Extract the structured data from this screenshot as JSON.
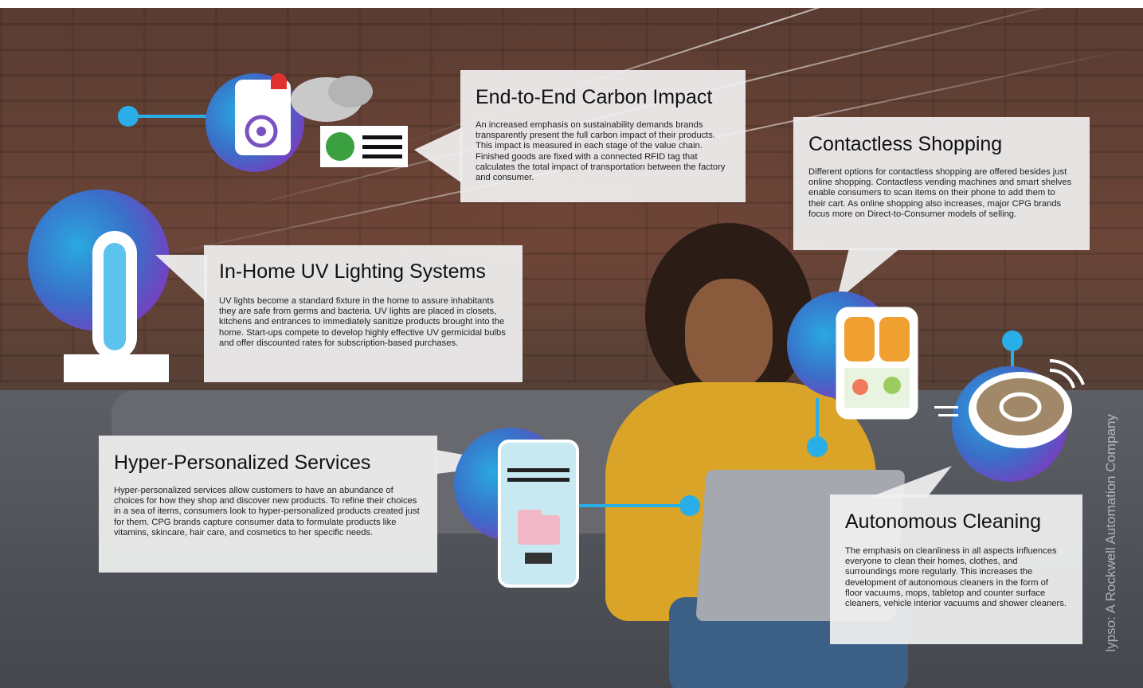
{
  "cards": {
    "carbon": {
      "title": "End-to-End Carbon Impact",
      "body": "An increased emphasis on sustainability demands brands transparently present the full carbon impact of their products. This impact is measured in each stage of the value chain. Finished goods are fixed with a connected RFID tag that calculates the total impact of transportation between the factory and consumer."
    },
    "contactless": {
      "title": "Contactless Shopping",
      "body": "Different options for contactless shopping are offered besides just online shopping. Contactless vending machines and smart shelves enable consumers to scan items on their phone to add them to their cart. As online shopping also increases, major CPG brands focus more on Direct-to-Consumer models of selling."
    },
    "uv": {
      "title": "In-Home UV Lighting Systems",
      "body": "UV lights become a standard fixture in the home to assure inhabitants they are safe from germs and bacteria. UV lights are placed in closets, kitchens and entrances to immediately sanitize products brought into the home. Start-ups compete to develop highly effective UV germicidal bulbs and offer discounted rates for subscription-based purchases."
    },
    "personalized": {
      "title": "Hyper-Personalized Services",
      "body": "Hyper-personalized services allow customers to have an abundance of choices for how they shop and discover new products. To refine their choices in a sea of items, consumers look to hyper-personalized products created just for them. CPG brands capture consumer data to formulate products like vitamins, skincare, hair care, and cosmetics to her specific needs."
    },
    "cleaning": {
      "title": "Autonomous Cleaning",
      "body": "The emphasis on cleanliness in all aspects influences everyone to clean their homes, clothes, and surroundings more regularly. This increases the development of autonomous cleaners in the form of floor vacuums, mops, tabletop and counter surface cleaners, vehicle interior vacuums and shower cleaners."
    }
  },
  "icons": {
    "carbon": "speaker-alarm-cloud-recycle-icon",
    "uv": "uv-lamp-icon",
    "personalized": "smartphone-products-icon",
    "contactless": "smart-vending-shelf-icon",
    "cleaning": "robot-vacuum-icon"
  },
  "watermark": "lypso: A Rockwell Automation Company",
  "colors": {
    "accent": "#29aee8",
    "orb_purple": "#7a3cc0",
    "card_bg": "#f0f0f0"
  }
}
